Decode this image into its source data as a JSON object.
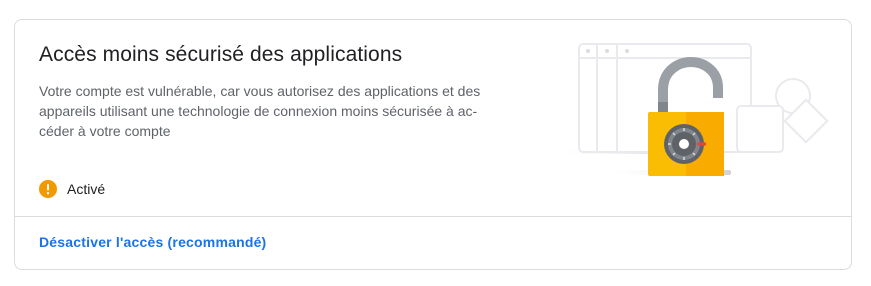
{
  "card": {
    "title": "Accès moins sécurisé des applications",
    "description": "Votre compte est vulnérable, car vous autorisez des applications et des appareils utilisant une technologie de connexion moins sécurisée à ac-céder à votre compte",
    "status": {
      "icon": "warning-icon",
      "color": "#f29900",
      "label": "Activé"
    },
    "action": {
      "label": "Désactiver l'accès (recommandé)",
      "color": "#1a73e8"
    },
    "illustration": {
      "icon": "open-padlock-illustration",
      "lock_color": "#f9ab00"
    }
  }
}
